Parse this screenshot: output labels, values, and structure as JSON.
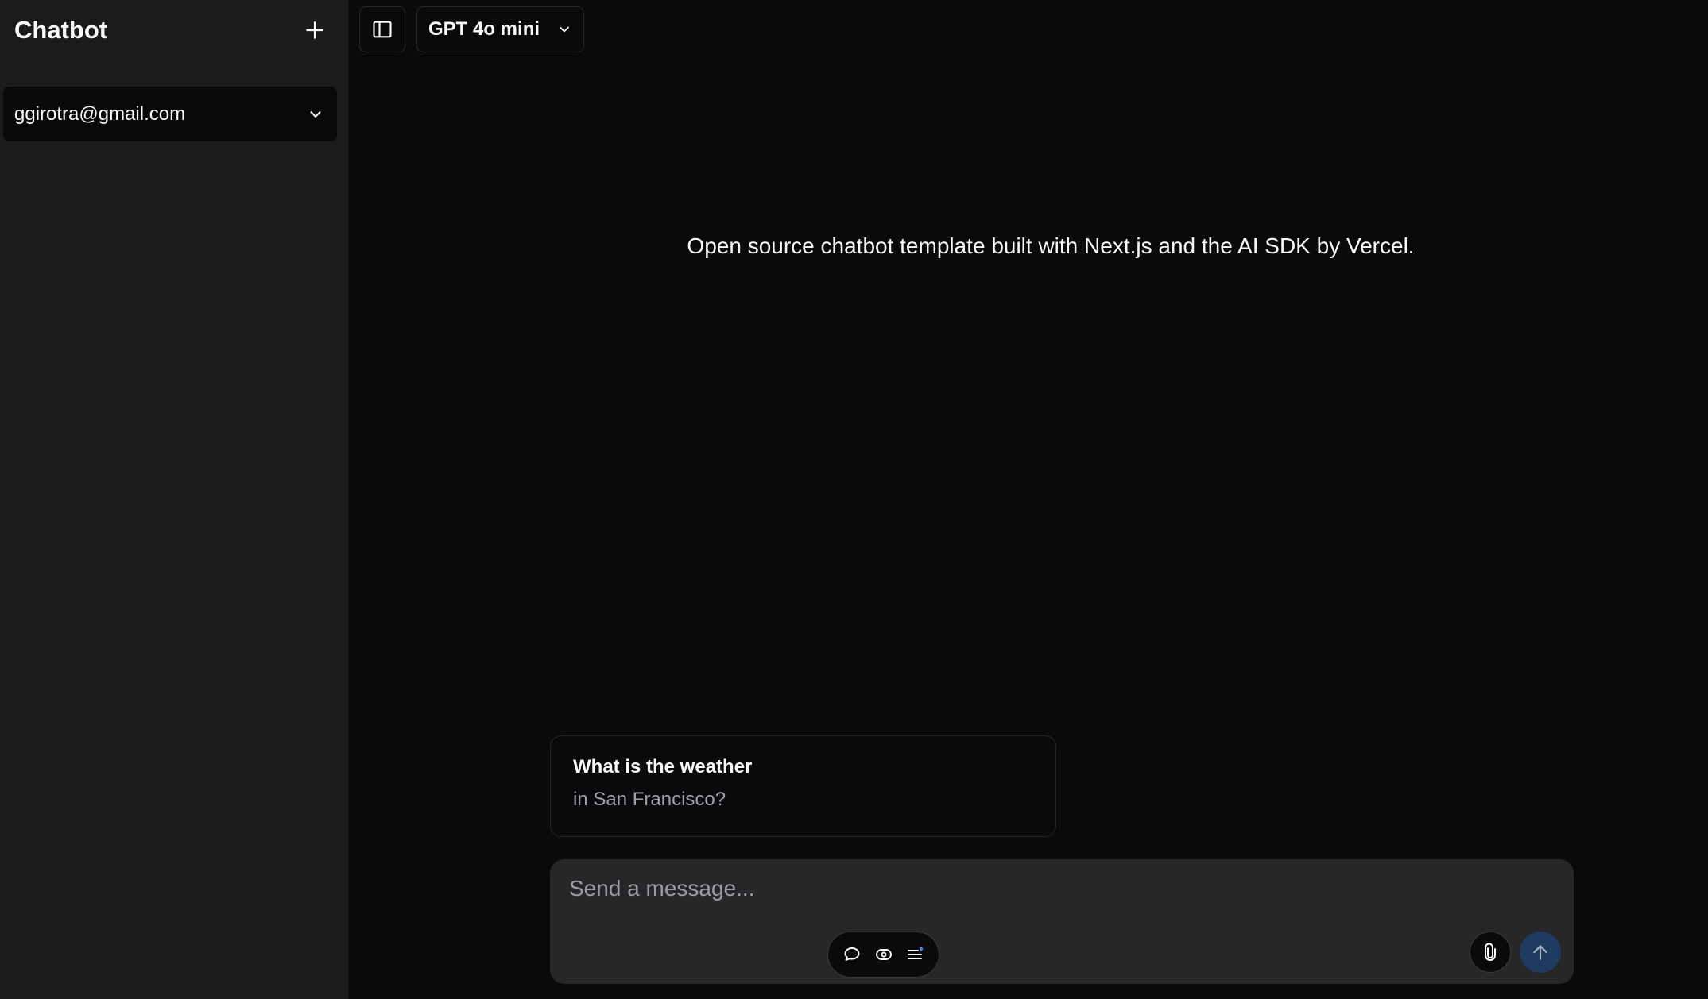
{
  "sidebar": {
    "title": "Chatbot",
    "new_chat_icon": "plus-icon",
    "user": {
      "email": "ggirotra@gmail.com",
      "menu_icon": "chevron-down-icon"
    }
  },
  "header": {
    "sidebar_toggle_icon": "sidebar-panel-icon",
    "model_selector": {
      "label": "GPT 4o mini",
      "icon": "chevron-down-icon"
    }
  },
  "main": {
    "greeting": "Open source chatbot template built with Next.js and the AI SDK by Vercel."
  },
  "suggestions": [
    {
      "title": "What is the weather",
      "subtitle": "in San Francisco?"
    }
  ],
  "composer": {
    "placeholder": "Send a message...",
    "mode_icons": [
      "chat-bubble-icon",
      "eye-toggle-icon",
      "list-icon"
    ],
    "attach_icon": "paperclip-icon",
    "send_icon": "arrow-up-icon"
  },
  "colors": {
    "background": "#0a0a0c",
    "sidebar": "#1b1b1e",
    "composer": "#27272a",
    "send_button": "#1f3a5f",
    "accent_dot": "#3b82f6"
  }
}
